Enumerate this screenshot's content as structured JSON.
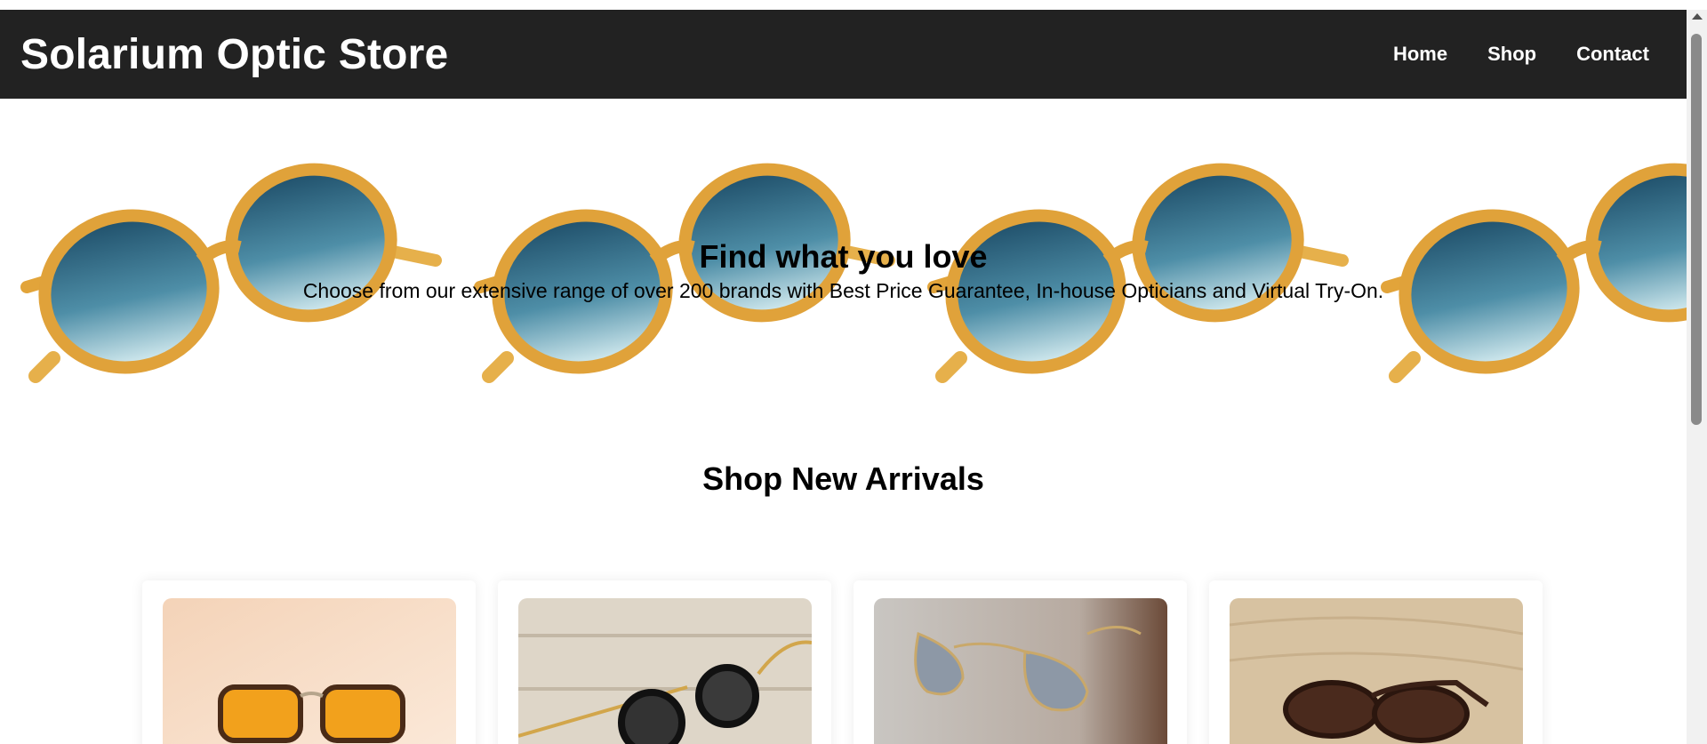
{
  "header": {
    "brand": "Solarium Optic Store",
    "nav": [
      "Home",
      "Shop",
      "Contact"
    ]
  },
  "hero": {
    "title": "Find what you love",
    "subtitle": "Choose from our extensive range of over 200 brands with Best Price Guarantee, In-house Opticians and Virtual Try-On."
  },
  "arrivals": {
    "title": "Shop New Arrivals",
    "products": [
      {
        "image": "amber-lens-tortoise-sunglasses"
      },
      {
        "image": "round-side-shield-sunglasses"
      },
      {
        "image": "gold-aviator-sunglasses"
      },
      {
        "image": "tortoise-cat-eye-sunglasses"
      }
    ]
  },
  "colors": {
    "navbar": "#222222",
    "navText": "#ffffff",
    "frame": "#e8a735",
    "lens": "#2f6f8a"
  }
}
